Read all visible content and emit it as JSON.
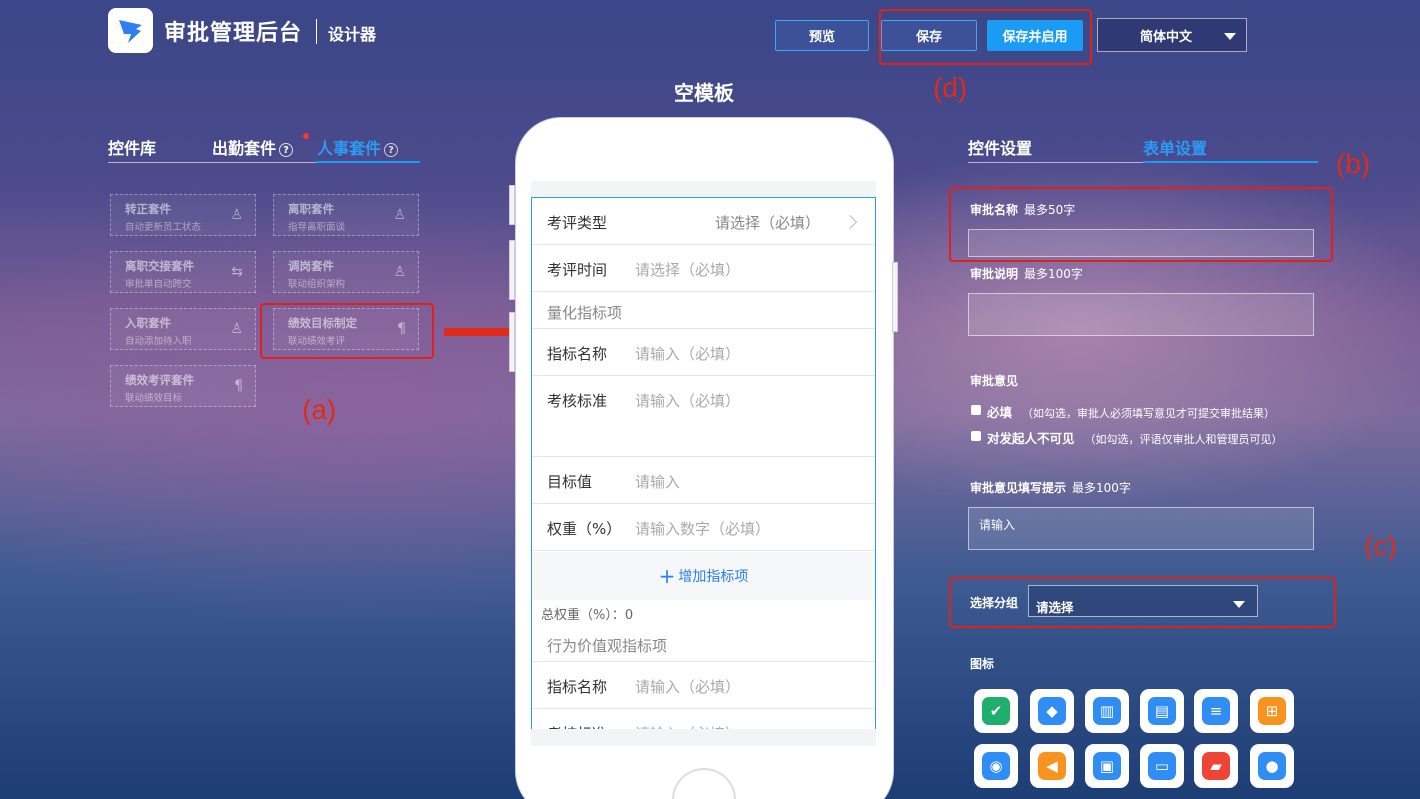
{
  "header": {
    "brand": "审批管理后台",
    "subtitle": "设计器",
    "preview_label": "预览",
    "save_label": "保存",
    "save_enable_label": "保存并启用",
    "language": "简体中文"
  },
  "template_title": "空模板",
  "annotations": {
    "a": "(a)",
    "b": "(b)",
    "c": "(c)",
    "d": "(d)"
  },
  "left_panel": {
    "tabs": [
      {
        "label": "控件库"
      },
      {
        "label": "出勤套件",
        "help": "?"
      },
      {
        "label": "人事套件",
        "help": "?"
      }
    ],
    "cards": [
      {
        "title": "转正套件",
        "desc": "自动更新员工状态",
        "icon": "person-icon"
      },
      {
        "title": "离职套件",
        "desc": "指导离职面谈",
        "icon": "person-icon"
      },
      {
        "title": "离职交接套件",
        "desc": "审批单自动跨交",
        "icon": "swap-icon"
      },
      {
        "title": "调岗套件",
        "desc": "联动组织架构",
        "icon": "person-icon"
      },
      {
        "title": "入职套件",
        "desc": "自动添加待入职",
        "icon": "person-icon"
      },
      {
        "title": "绩效目标制定",
        "desc": "联动绩效考评",
        "icon": "paragraph-icon"
      },
      {
        "title": "绩效考评套件",
        "desc": "联动绩效目标",
        "icon": "paragraph-icon"
      }
    ]
  },
  "phone_form": {
    "rows": [
      {
        "label": "考评类型",
        "placeholder": "请选择（必填）"
      },
      {
        "label": "考评时间",
        "placeholder": "请选择（必填）"
      },
      {
        "section": "量化指标项"
      },
      {
        "label": "指标名称",
        "placeholder": "请输入（必填）"
      },
      {
        "label": "考核标准",
        "placeholder": "请输入（必填）"
      },
      {
        "label": "目标值",
        "placeholder": "请输入"
      },
      {
        "label": "权重（%）",
        "placeholder": "请输入数字（必填）"
      }
    ],
    "add_label": "增加指标项",
    "total_weight": "总权重（%）：0",
    "section2": "行为价值观指标项",
    "rows2": [
      {
        "label": "指标名称",
        "placeholder": "请输入（必填）"
      },
      {
        "label": "考核标准",
        "placeholder": "请输入（必填）"
      }
    ]
  },
  "right_panel": {
    "tabs": [
      {
        "label": "控件设置"
      },
      {
        "label": "表单设置"
      }
    ],
    "approval_name": {
      "label": "审批名称",
      "hint": "最多50字",
      "value": ""
    },
    "approval_desc": {
      "label": "审批说明",
      "hint": "最多100字",
      "value": ""
    },
    "opinion": {
      "label": "审批意见",
      "required_label": "必填",
      "required_hint": "（如勾选，审批人必须填写意见才可提交审批结果）",
      "hidden_label": "对发起人不可见",
      "hidden_hint": "（如勾选，评语仅审批人和管理员可见）"
    },
    "opinion_tip": {
      "label": "审批意见填写提示",
      "hint": "最多100字",
      "value": "请输入"
    },
    "group": {
      "label": "选择分组",
      "value": "请选择"
    },
    "icons_label": "图标",
    "icons": [
      {
        "name": "person-check-icon",
        "color": "#1fae6b",
        "glyph": "✔"
      },
      {
        "name": "bag-icon",
        "color": "#2f8df4",
        "glyph": "◆"
      },
      {
        "name": "building-icon",
        "color": "#2f8df4",
        "glyph": "▥"
      },
      {
        "name": "store-icon",
        "color": "#2f8df4",
        "glyph": "▤"
      },
      {
        "name": "garage-icon",
        "color": "#2f8df4",
        "glyph": "≡"
      },
      {
        "name": "cart-icon",
        "color": "#f7931e",
        "glyph": "⊞"
      },
      {
        "name": "support-icon",
        "color": "#2f8df4",
        "glyph": "◉"
      },
      {
        "name": "megaphone-icon",
        "color": "#f7931e",
        "glyph": "◀"
      },
      {
        "name": "id-card-icon",
        "color": "#2f8df4",
        "glyph": "▣"
      },
      {
        "name": "card-icon",
        "color": "#2f8df4",
        "glyph": "▭"
      },
      {
        "name": "ticket-icon",
        "color": "#ef4538",
        "glyph": "▰"
      },
      {
        "name": "person-settings-icon",
        "color": "#2f8df4",
        "glyph": "●"
      }
    ]
  }
}
